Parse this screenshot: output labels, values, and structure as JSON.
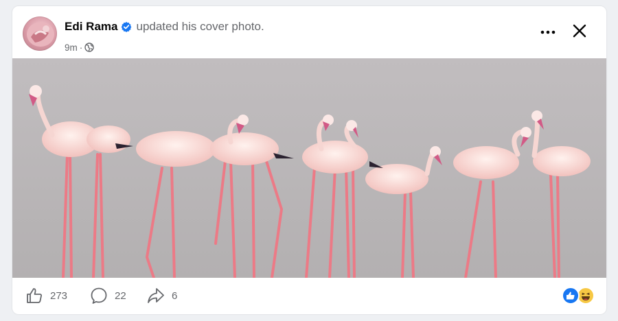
{
  "post": {
    "author": "Edi Rama",
    "action": "updated his cover photo.",
    "time": "9m",
    "separator": "·",
    "privacy_icon": "globe-icon",
    "verified_icon": "verified-badge-icon",
    "menu_icon": "more-options-icon",
    "close_icon": "close-icon"
  },
  "stats": {
    "likes": "273",
    "comments": "22",
    "shares": "6",
    "like_icon": "thumbs-up-icon",
    "comment_icon": "comment-icon",
    "share_icon": "share-icon"
  },
  "reactions": {
    "items": [
      "like-reaction-icon",
      "haha-reaction-icon"
    ]
  },
  "colors": {
    "brand": "#1877f2",
    "text_primary": "#050505",
    "text_secondary": "#65676b",
    "photo_background": "#b9b6b7",
    "flamingo": "#f3c8c4",
    "leg": "#e8707c"
  }
}
